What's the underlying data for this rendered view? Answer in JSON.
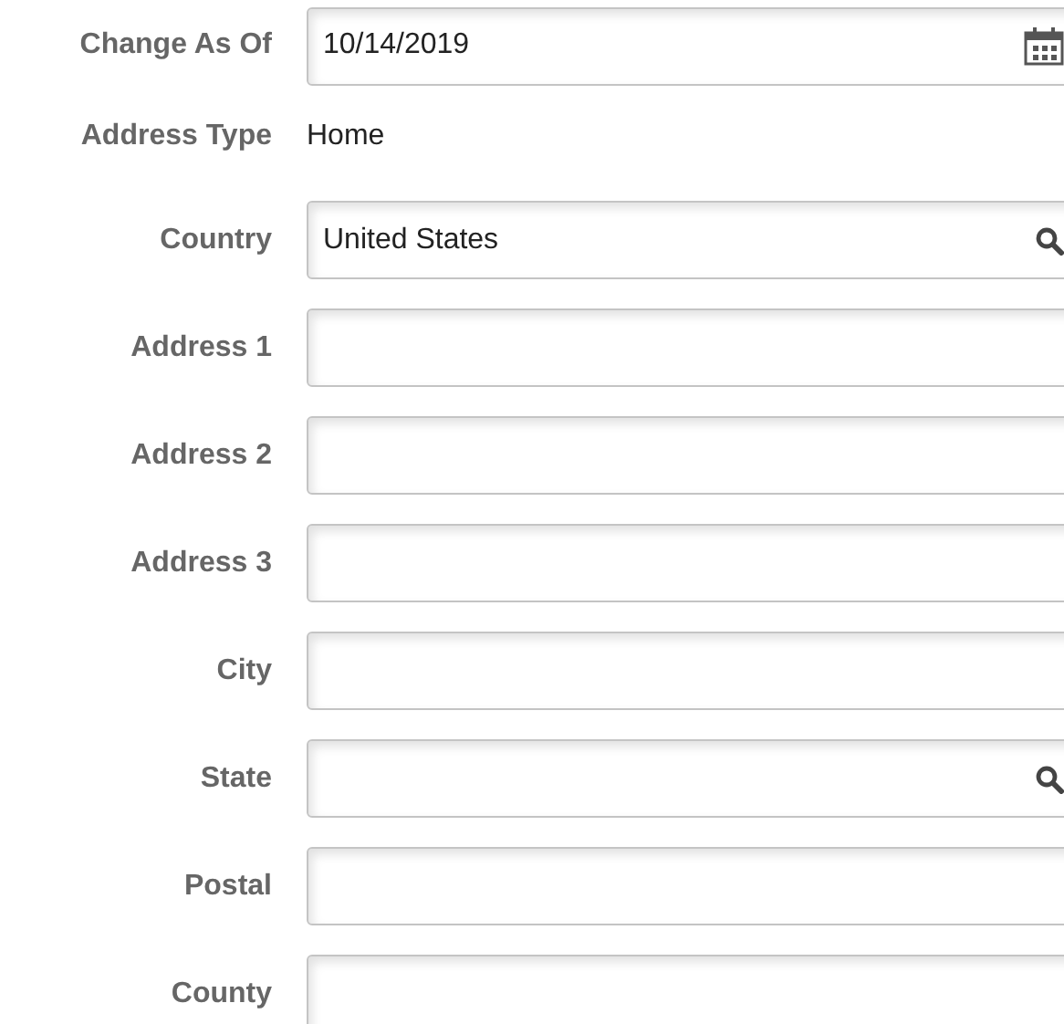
{
  "fields": [
    {
      "label": "Change As Of",
      "kind": "date",
      "value": "10/14/2019"
    },
    {
      "label": "Address Type",
      "kind": "static",
      "value": "Home"
    },
    {
      "label": "Country",
      "kind": "lookup",
      "value": "United States"
    },
    {
      "label": "Address 1",
      "kind": "input"
    },
    {
      "label": "Address 2",
      "kind": "input"
    },
    {
      "label": "Address 3",
      "kind": "input"
    },
    {
      "label": "City",
      "kind": "input"
    },
    {
      "label": "State",
      "kind": "lookup"
    },
    {
      "label": "Postal",
      "kind": "input"
    },
    {
      "label": "County",
      "kind": "input"
    }
  ]
}
